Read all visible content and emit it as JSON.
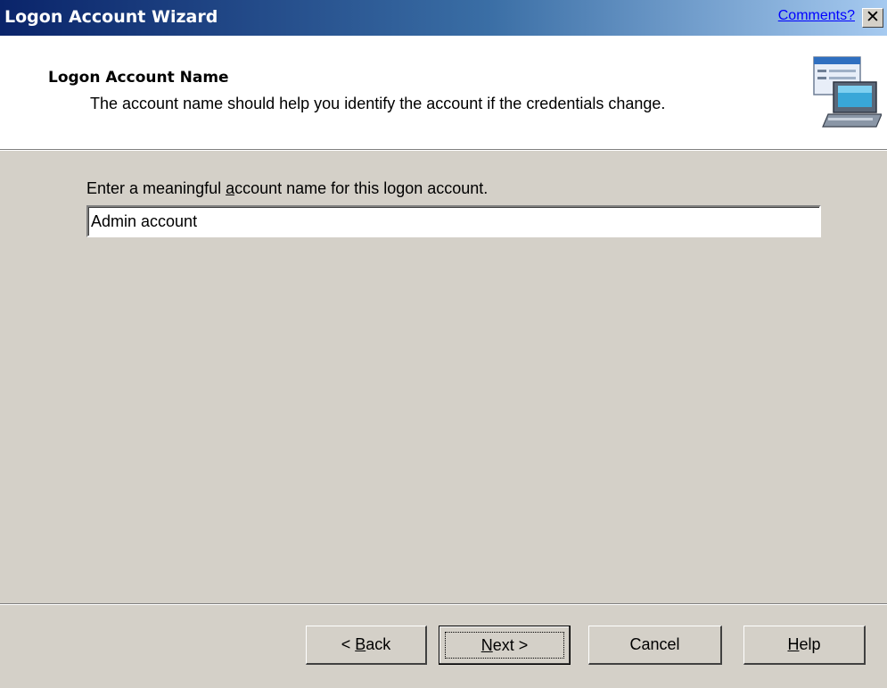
{
  "window": {
    "title": "Logon Account Wizard",
    "comments_link": "Comments?",
    "close_glyph": "✕"
  },
  "header": {
    "title": "Logon Account Name",
    "subtitle": "The account name should help you identify the account if the credentials change.",
    "icon": "computer-monitor-icon"
  },
  "body": {
    "prompt_before": "Enter a meaningful ",
    "prompt_mnemonic": "a",
    "prompt_after": "ccount name for this logon account.",
    "account_name_value": "Admin account"
  },
  "buttons": {
    "back_prefix": "< ",
    "back_mnemonic": "B",
    "back_rest": "ack",
    "next_mnemonic": "N",
    "next_rest": "ext >",
    "cancel": "Cancel",
    "help_mnemonic": "H",
    "help_rest": "elp"
  },
  "colors": {
    "titlebar_start": "#0a246a",
    "titlebar_end": "#a6caf0",
    "dialog_face": "#d4d0c8",
    "link": "#0000ff"
  }
}
